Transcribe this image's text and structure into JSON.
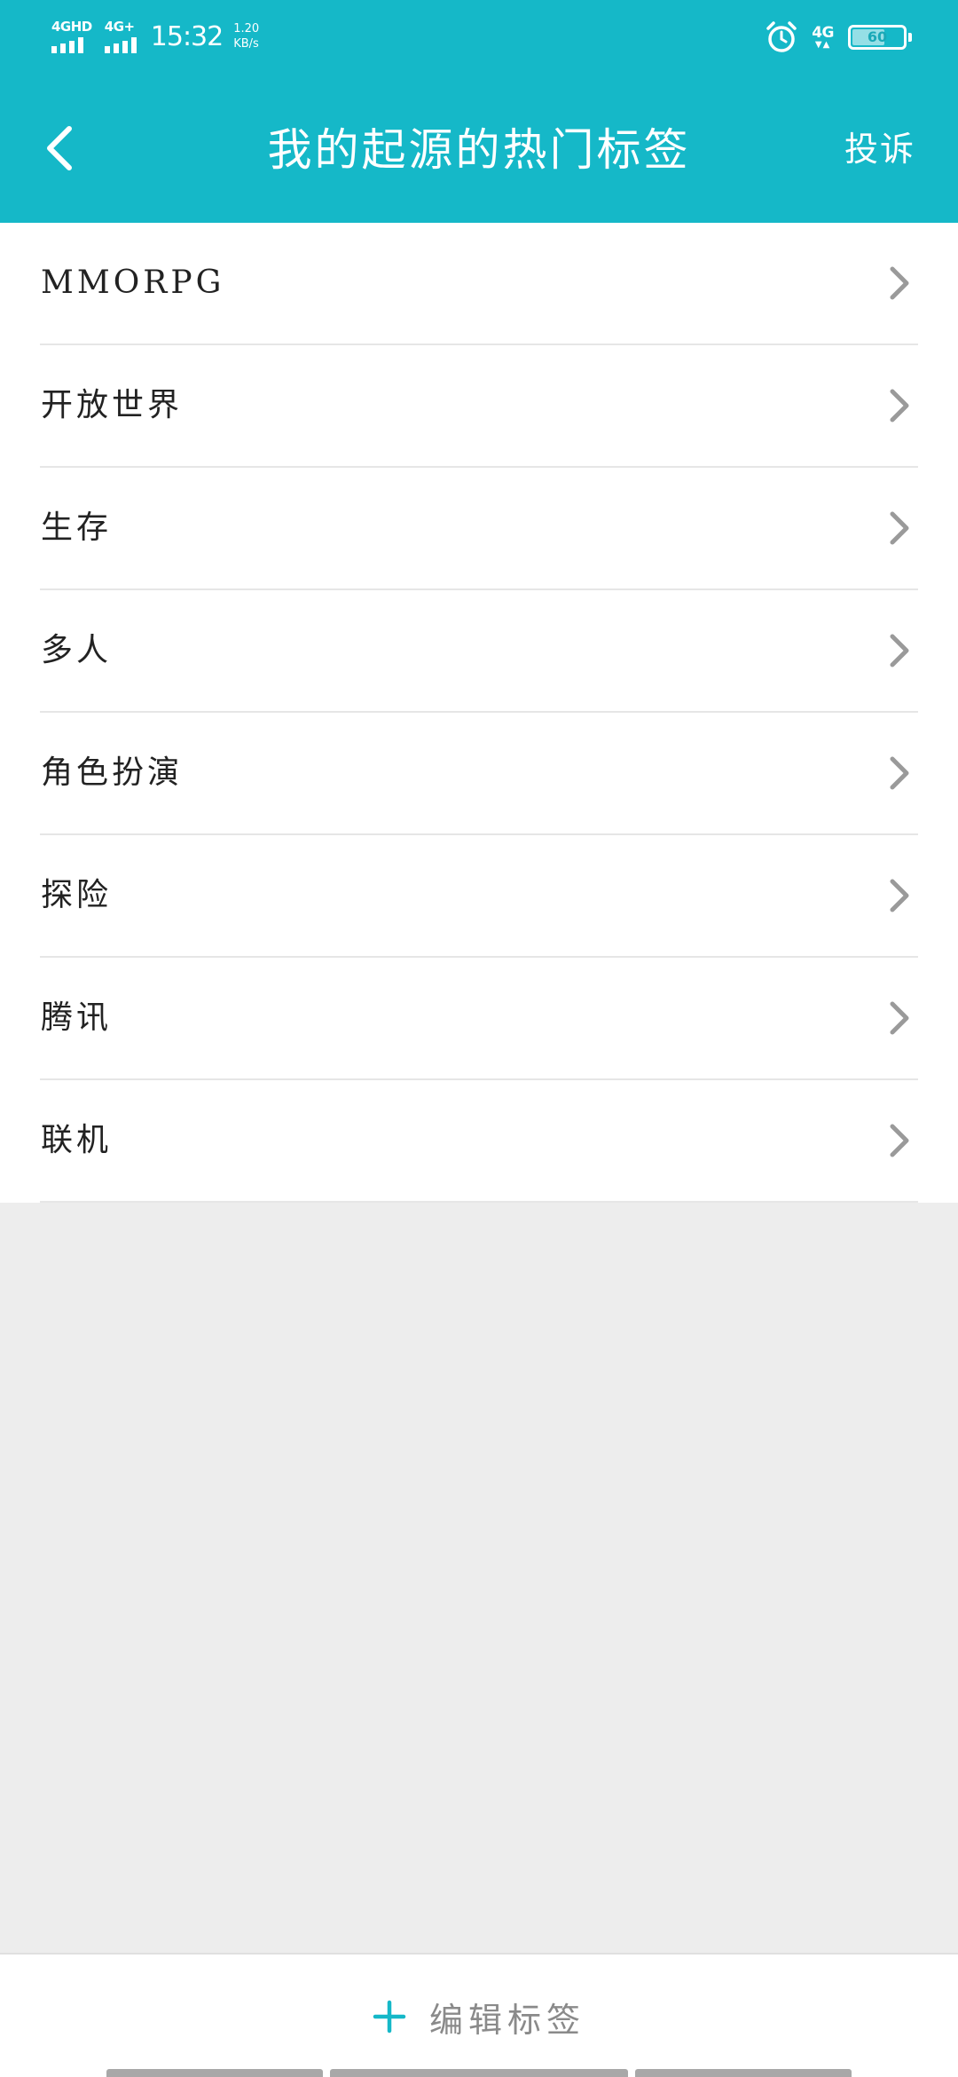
{
  "status_bar": {
    "net1_label": "4GHD",
    "net2_label": "4G+",
    "time": "15:32",
    "speed_value": "1.20",
    "speed_unit": "KB/s",
    "net_right_label": "4G",
    "battery": "60"
  },
  "header": {
    "title": "我的起源的热门标签",
    "report_label": "投诉"
  },
  "tags": [
    {
      "label": "MMORPG"
    },
    {
      "label": "开放世界"
    },
    {
      "label": "生存"
    },
    {
      "label": "多人"
    },
    {
      "label": "角色扮演"
    },
    {
      "label": "探险"
    },
    {
      "label": "腾讯"
    },
    {
      "label": "联机"
    }
  ],
  "bottom": {
    "edit_label": "编辑标签"
  },
  "colors": {
    "accent": "#15b8c8",
    "background": "#ededed",
    "list_bg": "#ffffff",
    "text": "#222222",
    "muted": "#8a8a8a",
    "chevron": "#9a9a9a"
  },
  "icons": {
    "back": "chevron-left-icon",
    "row_arrow": "chevron-right-icon",
    "add": "plus-icon",
    "alarm": "alarm-icon",
    "battery": "battery-icon"
  }
}
